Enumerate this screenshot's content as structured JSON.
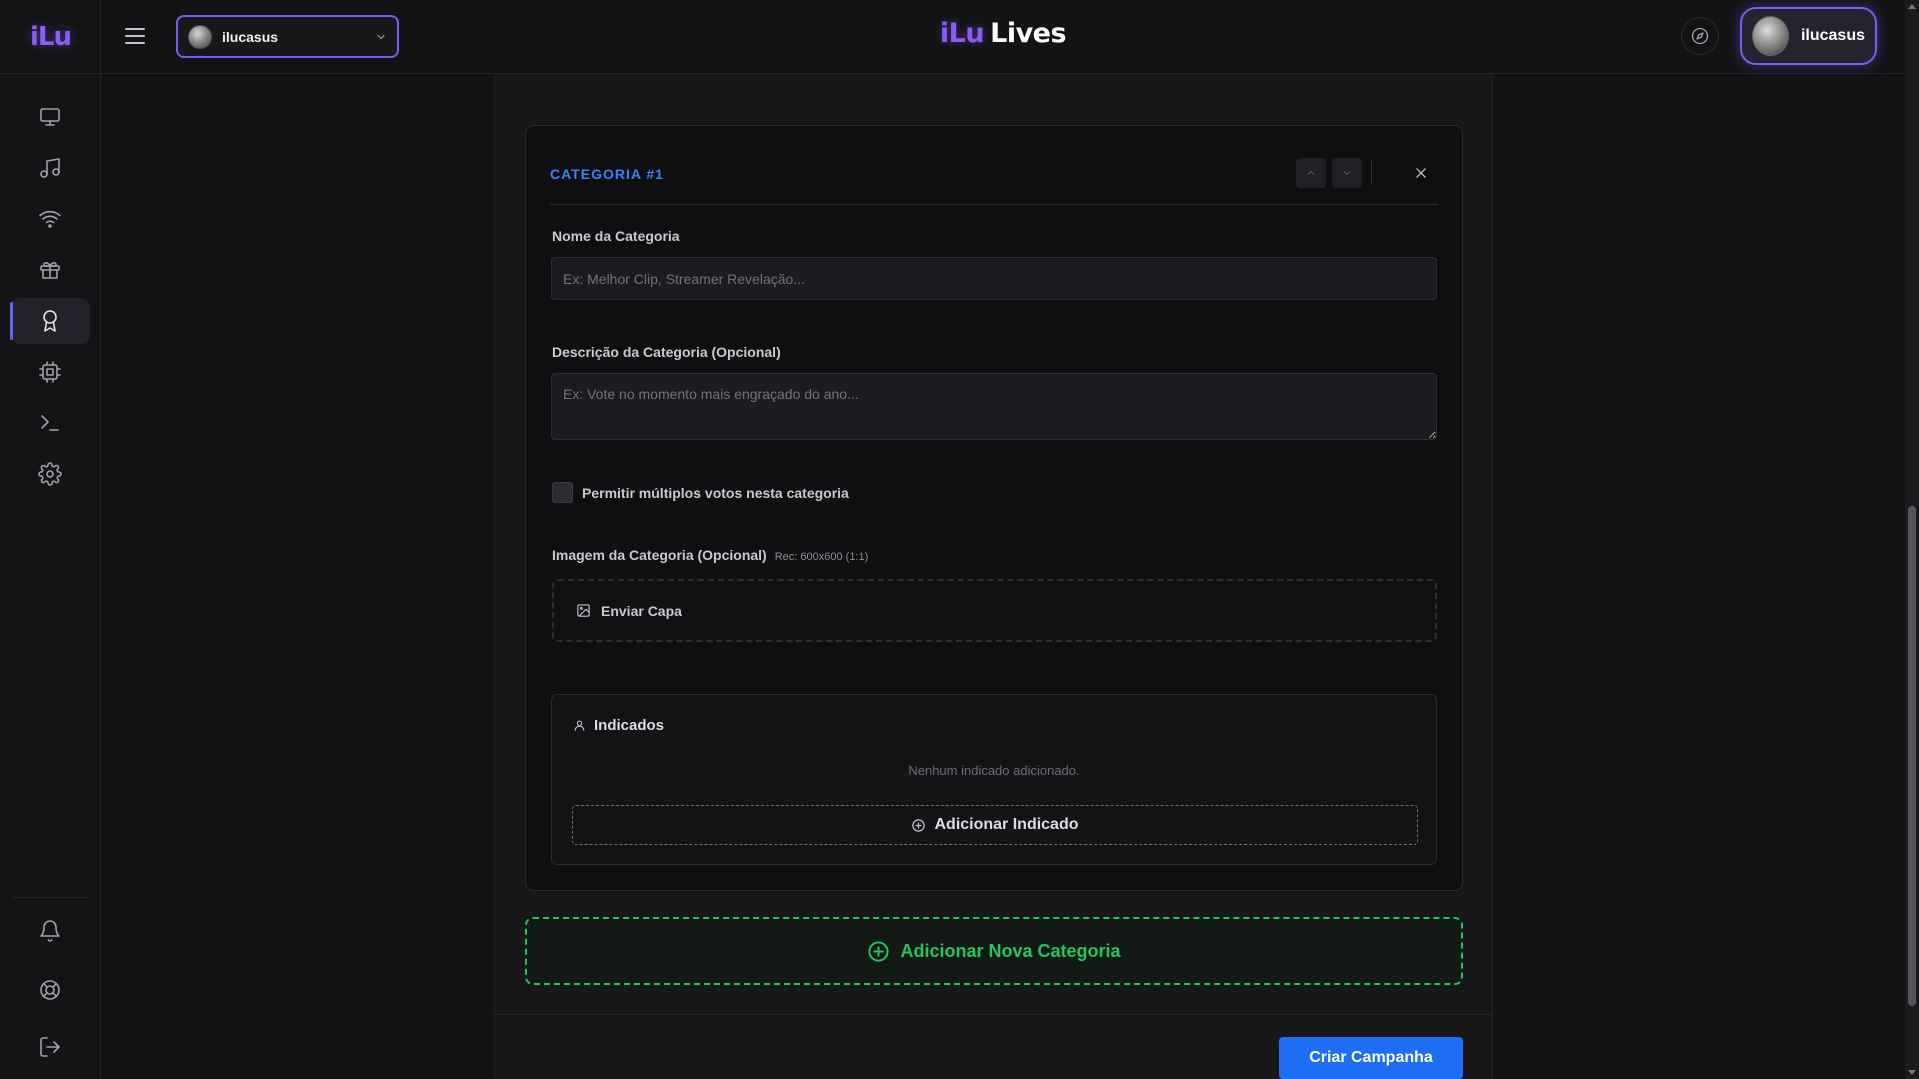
{
  "sidebar": {
    "logo": "iLu",
    "items": [
      {
        "name": "monitor-icon",
        "active": false
      },
      {
        "name": "music-note-icon",
        "active": false
      },
      {
        "name": "wifi-icon",
        "active": false
      },
      {
        "name": "gift-icon",
        "active": false
      },
      {
        "name": "award-icon",
        "active": true
      },
      {
        "name": "chip-icon",
        "active": false
      },
      {
        "name": "terminal-icon",
        "active": false
      },
      {
        "name": "gear-icon",
        "active": false
      }
    ],
    "bottom_items": [
      {
        "name": "bell-icon"
      },
      {
        "name": "life-buoy-icon"
      },
      {
        "name": "logout-icon"
      }
    ]
  },
  "topbar": {
    "channel_name": "ilucasus",
    "brand_prefix": "iLu",
    "brand_suffix": "Lives",
    "user_name": "ilucasus"
  },
  "category": {
    "title": "CATEGORIA #1",
    "name_label": "Nome da Categoria",
    "name_placeholder": "Ex: Melhor Clip, Streamer Revelação...",
    "name_value": "",
    "description_label": "Descrição da Categoria (Opcional)",
    "description_placeholder": "Ex: Vote no momento mais engraçado do ano...",
    "description_value": "",
    "multiple_votes_label": "Permitir múltiplos votos nesta categoria",
    "multiple_votes_checked": false,
    "image_label": "Imagem da Categoria (Opcional)",
    "image_hint": "Rec: 600x600 (1:1)",
    "upload_label": "Enviar Capa",
    "nominees_title": "Indicados",
    "nominees_empty": "Nenhum indicado adicionado.",
    "add_nominee_label": "Adicionar Indicado"
  },
  "actions": {
    "add_category_label": "Adicionar Nova Categoria",
    "create_campaign_label": "Criar Campanha"
  },
  "colors": {
    "accent_purple": "#7c5cf0",
    "title_blue": "#3b82f6",
    "add_green": "#22c55e",
    "primary_button": "#1d6ef5"
  }
}
